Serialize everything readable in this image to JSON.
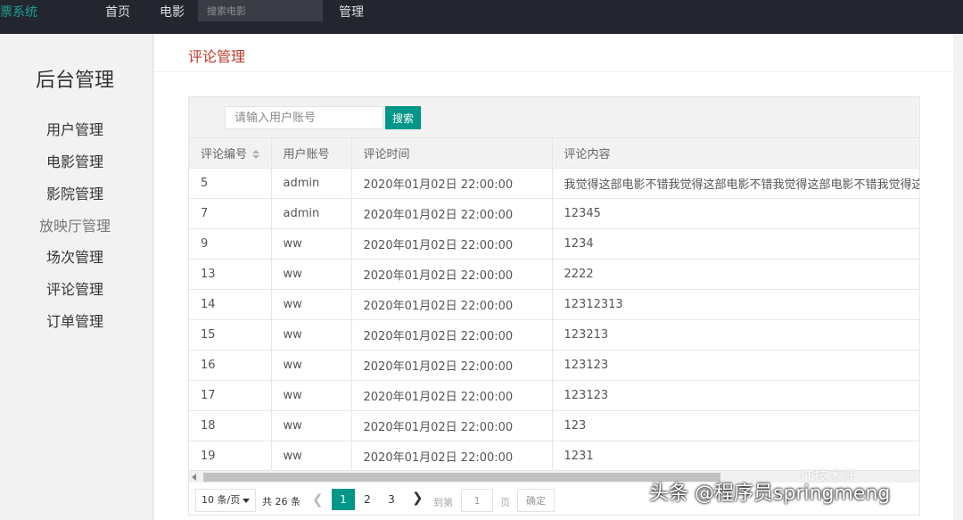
{
  "topbar": {
    "brand": "票系统",
    "nav": {
      "home": "首页",
      "movie": "电影",
      "manage": "管理"
    },
    "search_placeholder": "搜索电影"
  },
  "sidebar": {
    "title": "后台管理",
    "items": [
      {
        "label": "用户管理"
      },
      {
        "label": "电影管理"
      },
      {
        "label": "影院管理"
      },
      {
        "label": "放映厅管理"
      },
      {
        "label": "场次管理"
      },
      {
        "label": "评论管理"
      },
      {
        "label": "订单管理"
      }
    ]
  },
  "main": {
    "title": "评论管理",
    "search": {
      "placeholder": "请输入用户账号",
      "button": "搜索"
    },
    "table": {
      "headers": [
        "评论编号",
        "用户账号",
        "评论时间",
        "评论内容"
      ],
      "rows": [
        [
          "5",
          "admin",
          "2020年01月02日 22:00:00",
          "我觉得这部电影不错我觉得这部电影不错我觉得这部电影不错我觉得这部电影不错"
        ],
        [
          "7",
          "admin",
          "2020年01月02日 22:00:00",
          "12345"
        ],
        [
          "9",
          "ww",
          "2020年01月02日 22:00:00",
          "1234"
        ],
        [
          "13",
          "ww",
          "2020年01月02日 22:00:00",
          "2222"
        ],
        [
          "14",
          "ww",
          "2020年01月02日 22:00:00",
          "12312313"
        ],
        [
          "15",
          "ww",
          "2020年01月02日 22:00:00",
          "123213"
        ],
        [
          "16",
          "ww",
          "2020年01月02日 22:00:00",
          "123123"
        ],
        [
          "17",
          "ww",
          "2020年01月02日 22:00:00",
          "123123"
        ],
        [
          "18",
          "ww",
          "2020年01月02日 22:00:00",
          "123"
        ],
        [
          "19",
          "ww",
          "2020年01月02日 22:00:00",
          "1231"
        ]
      ]
    },
    "pager": {
      "limit": "10 条/页",
      "total": "共 26 条",
      "pages": [
        "1",
        "2",
        "3"
      ],
      "current_page": "1",
      "goto_label": "到第",
      "goto_value": "1",
      "page_unit": "页",
      "confirm": "确定"
    }
  },
  "watermark": {
    "text": "头条 @程序员springmeng",
    "logo": "IT技术汗"
  },
  "colors": {
    "accent": "#009688",
    "title_red": "#c0392b",
    "topbar": "#23262e",
    "brand": "#1aa094"
  },
  "icons": {
    "sort": "sort-icon",
    "prev": "chevron-left-icon",
    "next": "chevron-right-icon",
    "dropdown": "caret-down-icon",
    "scroll_left": "scroll-left-arrow-icon"
  }
}
